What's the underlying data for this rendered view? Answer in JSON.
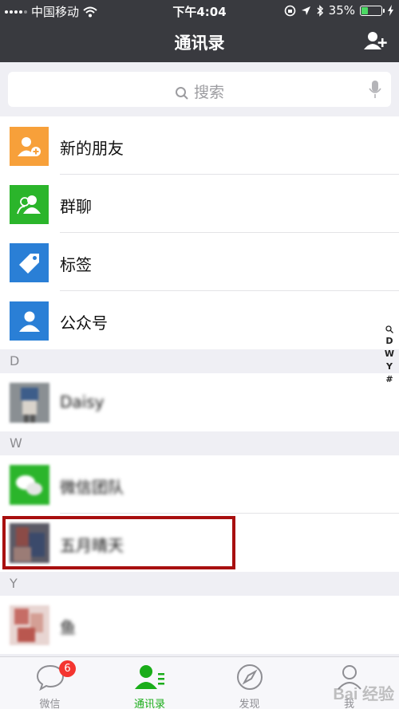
{
  "status_bar": {
    "carrier": "中国移动",
    "time": "下午4:04",
    "battery": "35%",
    "battery_level": 0.35
  },
  "nav": {
    "title": "通讯录"
  },
  "search": {
    "placeholder": "搜索"
  },
  "fixed_items": [
    {
      "label": "新的朋友",
      "color": "#f7a03a",
      "icon": "add-friend-icon"
    },
    {
      "label": "群聊",
      "color": "#2bb52b",
      "icon": "group-chat-icon"
    },
    {
      "label": "标签",
      "color": "#2a7fd6",
      "icon": "tag-icon"
    },
    {
      "label": "公众号",
      "color": "#2a7fd6",
      "icon": "official-account-icon"
    }
  ],
  "sections": [
    {
      "letter": "D",
      "contacts": [
        {
          "name": "Daisy"
        }
      ]
    },
    {
      "letter": "W",
      "contacts": [
        {
          "name": "微信团队"
        },
        {
          "name": "五月晴天"
        }
      ]
    },
    {
      "letter": "Y",
      "contacts": [
        {
          "name": "鱼"
        }
      ]
    }
  ],
  "index_bar": [
    "Q",
    "D",
    "W",
    "Y",
    "#"
  ],
  "tabs": [
    {
      "label": "微信",
      "badge": "6"
    },
    {
      "label": "通讯录"
    },
    {
      "label": "发现"
    },
    {
      "label": "我"
    }
  ],
  "watermark": "Bai 经验"
}
